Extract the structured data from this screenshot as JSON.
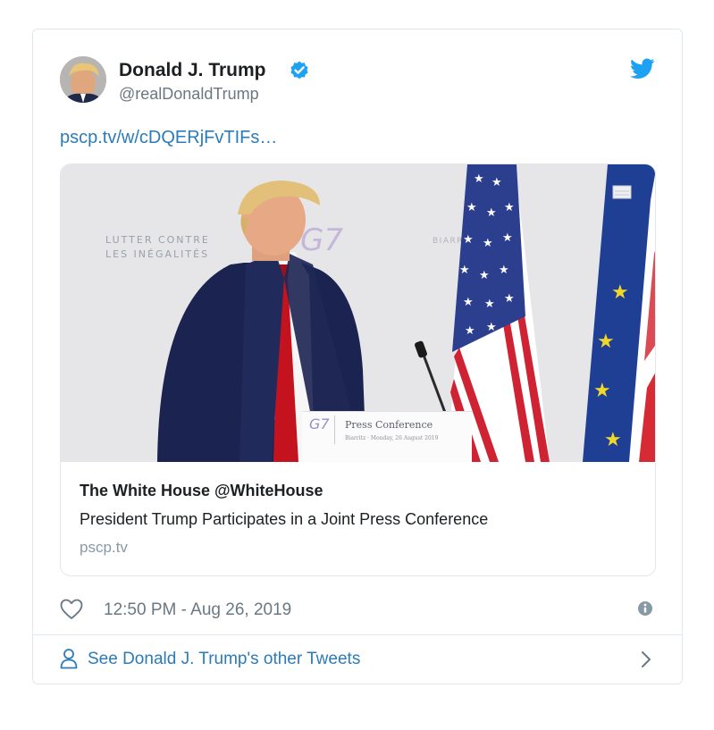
{
  "tweet": {
    "author": {
      "name": "Donald J. Trump",
      "handle": "@realDonaldTrump",
      "verified": true,
      "avatar_icon": "profile-photo"
    },
    "link_text": "pscp.tv/w/cDQERjFvTIFs…",
    "media_card": {
      "image_texts": {
        "backdrop_line1": "LUTTER CONTRE",
        "backdrop_line2": "LES INÉGALITÉS",
        "backdrop_mid": "BIARRITZ",
        "podium_logo": "G7",
        "podium_title": "Press Conference",
        "podium_subtitle": "Biarritz · Monday, 26 August 2019"
      },
      "title": "The White House @WhiteHouse",
      "description": "President Trump Participates in a Joint Press Conference",
      "domain": "pscp.tv"
    },
    "timestamp": "12:50 PM - Aug 26, 2019",
    "see_more_label": "See Donald J. Trump's other Tweets"
  },
  "colors": {
    "link": "#2b7bb9",
    "twitter_blue": "#1da1f2",
    "muted_text": "#697882",
    "border": "#e1e8ed"
  },
  "icons": [
    "twitter-bird-icon",
    "verified-icon",
    "heart-icon",
    "info-icon",
    "person-icon",
    "chevron-right-icon"
  ]
}
